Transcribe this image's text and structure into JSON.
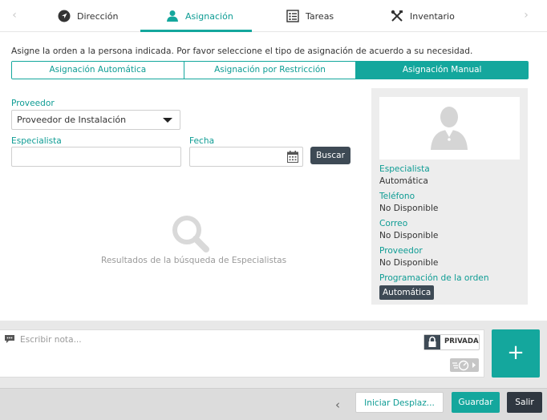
{
  "tabs": [
    {
      "label": "Dirección",
      "icon": "navigation-arrow-icon"
    },
    {
      "label": "Asignación",
      "icon": "person-icon",
      "active": true
    },
    {
      "label": "Tareas",
      "icon": "list-icon"
    },
    {
      "label": "Inventario",
      "icon": "tools-icon"
    }
  ],
  "intro_text": "Asigne la orden a la persona indicada. Por favor seleccione el tipo de asignación de acuerdo a su necesidad.",
  "assignment_types": [
    {
      "label": "Asignación Automática"
    },
    {
      "label": "Asignación por Restricción"
    },
    {
      "label": "Asignación Manual",
      "active": true
    }
  ],
  "form": {
    "proveedor_label": "Proveedor",
    "proveedor_value": "Proveedor de Instalación",
    "especialista_label": "Especialista",
    "especialista_value": "",
    "fecha_label": "Fecha",
    "fecha_value": "",
    "buscar_label": "Buscar"
  },
  "results": {
    "empty_text": "Resultados de la búsqueda de Especialistas"
  },
  "panel": {
    "especialista_label": "Especialista",
    "especialista_value": "Automática",
    "telefono_label": "Teléfono",
    "telefono_value": "No Disponible",
    "correo_label": "Correo",
    "correo_value": "No Disponible",
    "proveedor_label": "Proveedor",
    "proveedor_value": "No Disponible",
    "programacion_label": "Programación de la orden",
    "programacion_value": "Automática"
  },
  "note": {
    "placeholder": "Escribir nota...",
    "privada_label": "PRIVADA",
    "add_label": "+"
  },
  "footer": {
    "iniciar_label": "Iniciar Desplaz...",
    "guardar_label": "Guardar",
    "salir_label": "Salir"
  },
  "colors": {
    "accent": "#14a79d",
    "dark": "#3e4a55"
  }
}
